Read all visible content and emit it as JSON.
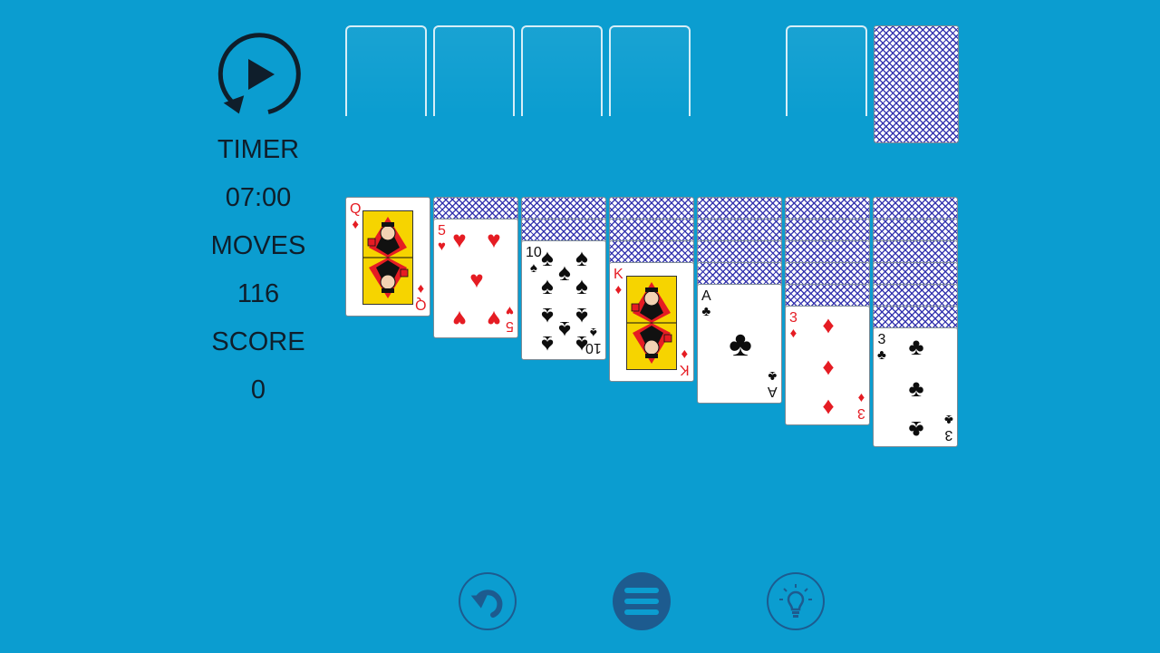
{
  "stats": {
    "timer_label": "TIMER",
    "timer_value": "07:00",
    "moves_label": "MOVES",
    "moves_value": "116",
    "score_label": "SCORE",
    "score_value": "0"
  },
  "icons": {
    "restart": "restart-play-icon",
    "undo": "undo-icon",
    "menu": "menu-icon",
    "hint": "lightbulb-hint-icon"
  },
  "colors": {
    "table": "#0b9dd0",
    "red_suit": "#e51c23",
    "black_suit": "#0d0d0d",
    "card_back": "#2828aa"
  },
  "foundations": [
    "",
    "",
    "",
    ""
  ],
  "waste": "",
  "stock": "face-down",
  "tableau": [
    {
      "hidden": 0,
      "rank": "Q",
      "suit": "♦",
      "suit_name": "diamonds",
      "color": "red"
    },
    {
      "hidden": 1,
      "rank": "5",
      "suit": "♥",
      "suit_name": "hearts",
      "color": "red"
    },
    {
      "hidden": 2,
      "rank": "10",
      "suit": "♠",
      "suit_name": "spades",
      "color": "black"
    },
    {
      "hidden": 3,
      "rank": "K",
      "suit": "♦",
      "suit_name": "diamonds",
      "color": "red"
    },
    {
      "hidden": 4,
      "rank": "A",
      "suit": "♣",
      "suit_name": "clubs",
      "color": "black"
    },
    {
      "hidden": 5,
      "rank": "3",
      "suit": "♦",
      "suit_name": "diamonds",
      "color": "red"
    },
    {
      "hidden": 6,
      "rank": "3",
      "suit": "♣",
      "suit_name": "clubs",
      "color": "black"
    }
  ]
}
